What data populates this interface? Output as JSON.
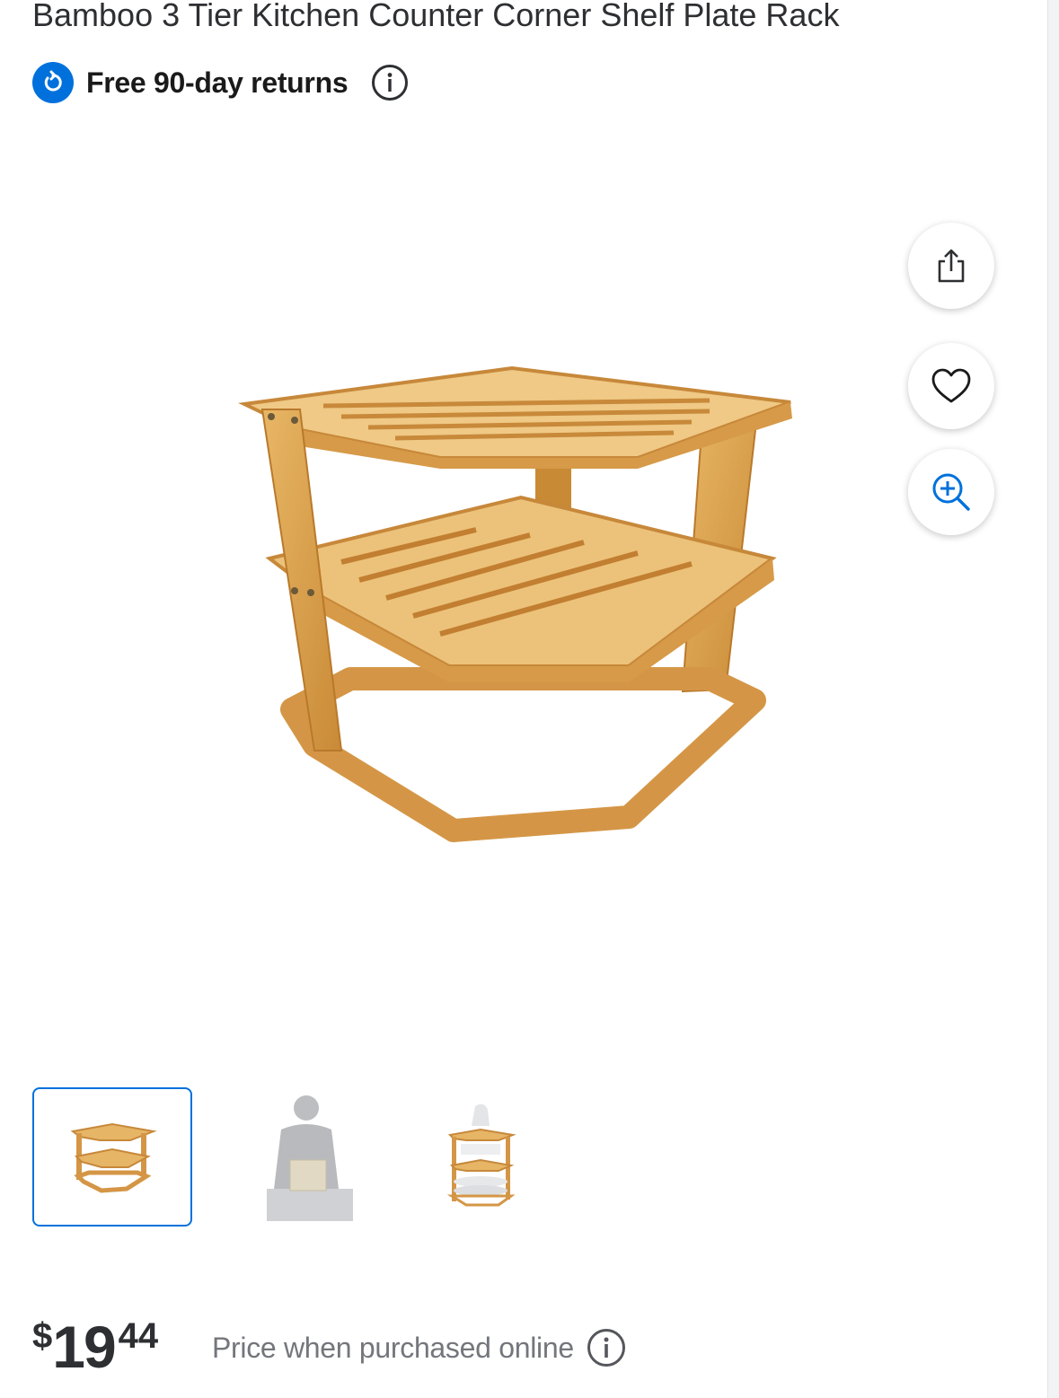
{
  "product": {
    "title": "Bamboo 3 Tier Kitchen Counter Corner Shelf Plate Rack"
  },
  "returns": {
    "label": "Free 90-day returns",
    "icon": "returns-icon",
    "info_icon": "info-icon"
  },
  "actions": [
    {
      "name": "share",
      "icon": "share-icon"
    },
    {
      "name": "favorite",
      "icon": "heart-icon"
    },
    {
      "name": "zoom",
      "icon": "zoom-in-icon"
    }
  ],
  "gallery": {
    "selected_index": 0,
    "thumbnails": [
      {
        "name": "thumbnail-rack"
      },
      {
        "name": "thumbnail-size-reference"
      },
      {
        "name": "thumbnail-rack-in-use"
      }
    ]
  },
  "price": {
    "currency": "$",
    "dollars": "19",
    "cents": "44",
    "note": "Price when purchased online"
  },
  "colors": {
    "accent": "#0071dc",
    "text": "#2e2f32",
    "muted": "#74767c",
    "bamboo": "#d9a04d"
  }
}
